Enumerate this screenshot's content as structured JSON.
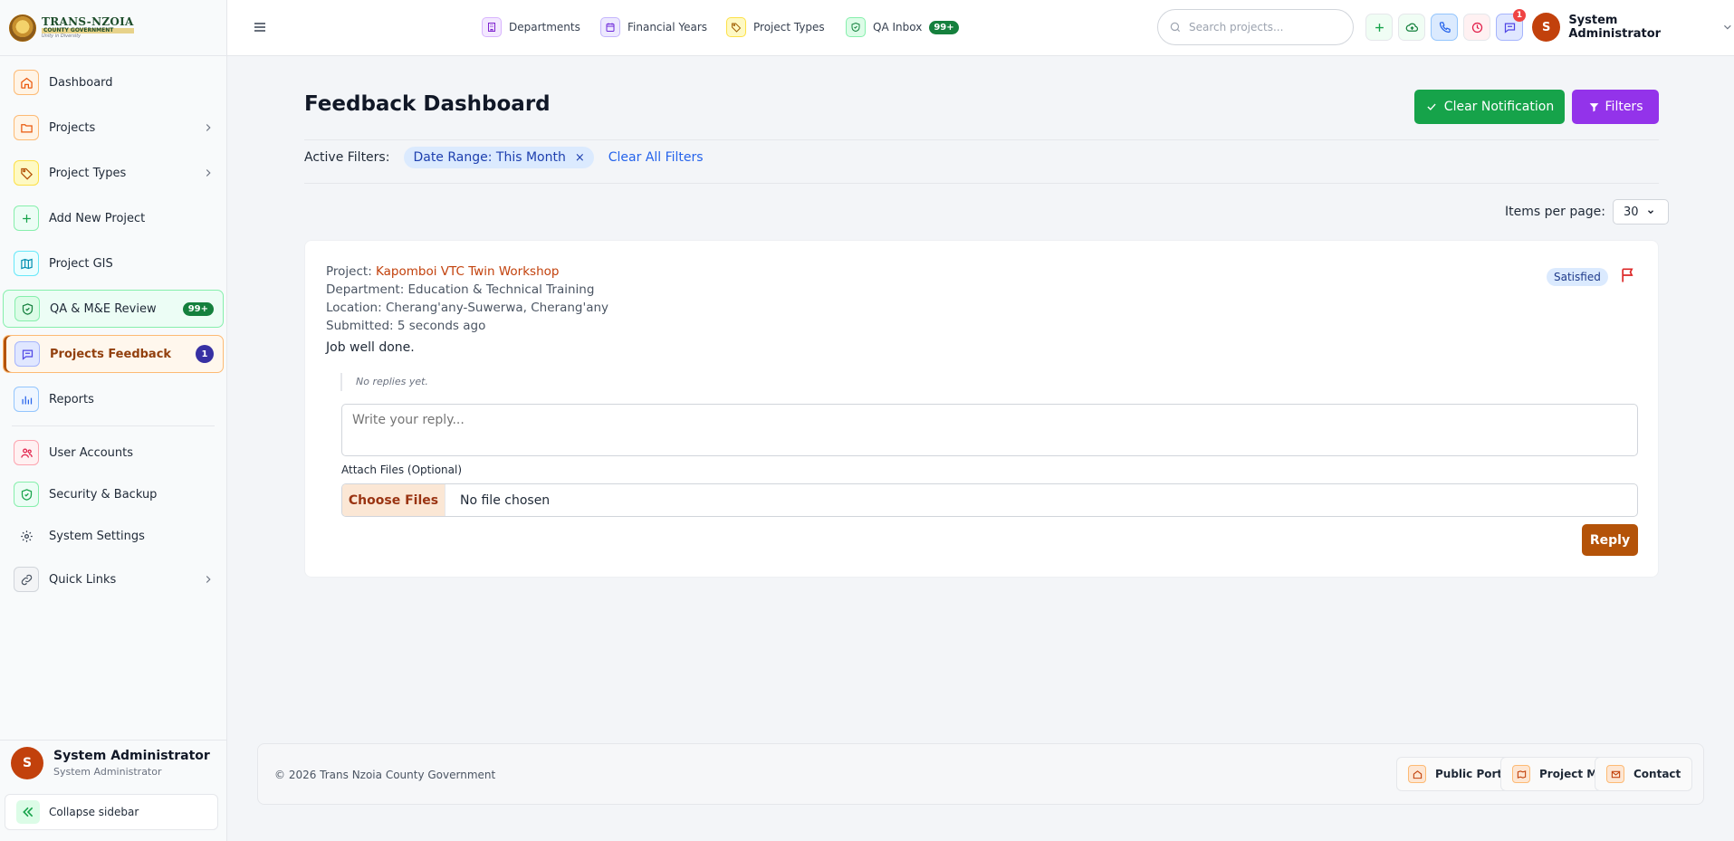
{
  "brand": {
    "line1": "TRANS-NZOIA",
    "line2": "COUNTY GOVERNMENT",
    "line3": "Unity in Diversity"
  },
  "sidebar": {
    "items": [
      {
        "label": "Dashboard",
        "icon": "home-icon"
      },
      {
        "label": "Projects",
        "icon": "folder-icon"
      },
      {
        "label": "Project Types",
        "icon": "tag-icon"
      },
      {
        "label": "Add New Project",
        "icon": "plus-icon"
      },
      {
        "label": "Project GIS",
        "icon": "map-icon"
      },
      {
        "label": "QA & M&E Review",
        "icon": "shield-check-icon",
        "badge": "99+"
      },
      {
        "label": "Projects Feedback",
        "icon": "message-icon",
        "badge": "1"
      },
      {
        "label": "Reports",
        "icon": "bar-chart-icon"
      },
      {
        "label": "User Accounts",
        "icon": "users-icon"
      },
      {
        "label": "Security & Backup",
        "icon": "shield-icon"
      },
      {
        "label": "System Settings",
        "icon": "gear-icon"
      },
      {
        "label": "Quick Links",
        "icon": "link-icon"
      }
    ],
    "user": {
      "initial": "S",
      "name": "System Administrator",
      "role": "System Administrator"
    },
    "collapse_label": "Collapse sidebar"
  },
  "topbar": {
    "quick_links": [
      {
        "label": "Departments",
        "icon": "building-icon"
      },
      {
        "label": "Financial Years",
        "icon": "calendar-icon"
      },
      {
        "label": "Project Types",
        "icon": "tag-icon"
      },
      {
        "label": "QA Inbox",
        "icon": "shield-check-icon",
        "badge": "99+"
      }
    ],
    "search_placeholder": "Search projects...",
    "notification_count": "1",
    "user": {
      "initial": "S",
      "name": "System Administrator"
    }
  },
  "main": {
    "title": "Feedback Dashboard",
    "clear_notification_label": "Clear Notification",
    "filters_label": "Filters",
    "active_filters_label": "Active Filters:",
    "active_filter_chip": "Date Range: This Month",
    "chip_remove": "×",
    "clear_all_label": "Clear All Filters",
    "items_per_page_label": "Items per page:",
    "items_per_page_value": "30"
  },
  "feedback": {
    "project_prefix": "Project:",
    "project_name": "Kapomboi VTC Twin Workshop",
    "department": "Department: Education & Technical Training",
    "location": "Location: Cherang'any-Suwerwa, Cherang'any",
    "submitted": "Submitted: 5 seconds ago",
    "comment": "Job well done.",
    "status": "Satisfied",
    "no_replies": "No replies yet.",
    "reply_placeholder": "Write your reply...",
    "attach_label": "Attach Files (Optional)",
    "choose_files_label": "Choose Files",
    "no_file_label": "No file chosen",
    "reply_button": "Reply"
  },
  "footer": {
    "copyright": "© 2026 Trans Nzoia County Government",
    "links": [
      {
        "label": "Public Portal",
        "icon": "home-icon"
      },
      {
        "label": "Project Map",
        "icon": "map-icon"
      },
      {
        "label": "Contact",
        "icon": "mail-icon"
      }
    ]
  },
  "colors": {
    "accent": "#b45309",
    "green": "#16a34a",
    "purple": "#9333ea",
    "link": "#2563eb"
  }
}
